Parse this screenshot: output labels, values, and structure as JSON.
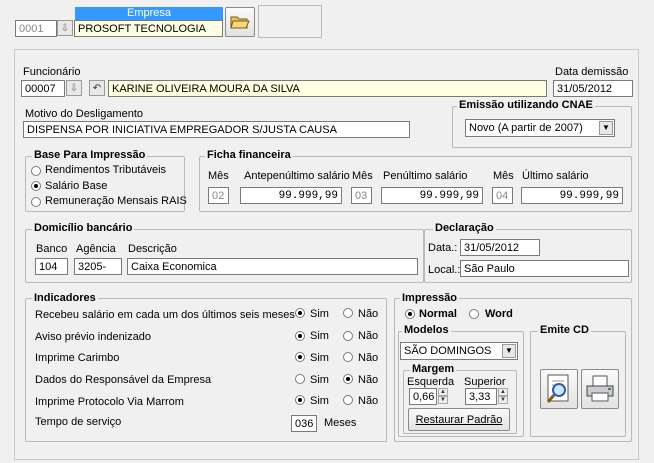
{
  "empresa": {
    "header_label": "Empresa",
    "code": "0001",
    "name": "PROSOFT TECNOLOGIA"
  },
  "funcionario": {
    "label": "Funcionário",
    "code": "00007",
    "name": "KARINE OLIVEIRA MOURA DA SILVA"
  },
  "data_demissao": {
    "label": "Data demissão",
    "value": "31/05/2012"
  },
  "motivo": {
    "label": "Motivo do Desligamento",
    "value": "DISPENSA POR INICIATIVA EMPREGADOR S/JUSTA CAUSA"
  },
  "cnae": {
    "title": "Emissão utilizando CNAE",
    "selected": "Novo (A partir de 2007)"
  },
  "base": {
    "title": "Base Para Impressão",
    "options": [
      "Rendimentos Tributáveis",
      "Salário Base",
      "Remuneração Mensais RAIS"
    ],
    "selected_index": 1
  },
  "ficha": {
    "title": "Ficha financeira",
    "mes_label": "Mês",
    "antepenultimo_label": "Antepenúltimo salário",
    "penultimo_label": "Penúltimo salário",
    "ultimo_label": "Último salário",
    "mes1": "02",
    "val1": "99.999,99",
    "mes2": "03",
    "val2": "99.999,99",
    "mes3": "04",
    "val3": "99.999,99"
  },
  "domicilio": {
    "title": "Domicílio bancário",
    "banco_label": "Banco",
    "agencia_label": "Agência",
    "descricao_label": "Descrição",
    "banco": "104",
    "agencia": "3205-",
    "descricao": "Caixa Economica"
  },
  "declaracao": {
    "title": "Declaração",
    "data_label": "Data.:",
    "data": "31/05/2012",
    "local_label": "Local.:",
    "local": "São Paulo"
  },
  "indicadores": {
    "title": "Indicadores",
    "sim": "Sim",
    "nao": "Não",
    "rows": [
      {
        "label": "Recebeu salário em cada um dos últimos seis meses",
        "value": "Sim"
      },
      {
        "label": "Aviso prévio indenizado",
        "value": "Sim"
      },
      {
        "label": "Imprime Carimbo",
        "value": "Sim"
      },
      {
        "label": "Dados do Responsável da Empresa",
        "value": "Não"
      },
      {
        "label": "Imprime Protocolo Via Marrom",
        "value": "Sim"
      }
    ],
    "tempo_label": "Tempo de serviço",
    "tempo_value": "036",
    "tempo_unit": "Meses"
  },
  "impressao": {
    "title": "Impressão",
    "normal": "Normal",
    "word": "Word",
    "selected": "Normal",
    "modelos_title": "Modelos",
    "modelo": "SÃO DOMINGOS",
    "margem_title": "Margem",
    "esquerda_label": "Esquerda",
    "superior_label": "Superior",
    "esquerda": "0,66",
    "superior": "3,33",
    "restaurar": "Restaurar Padrão",
    "emite_title": "Emite CD"
  }
}
